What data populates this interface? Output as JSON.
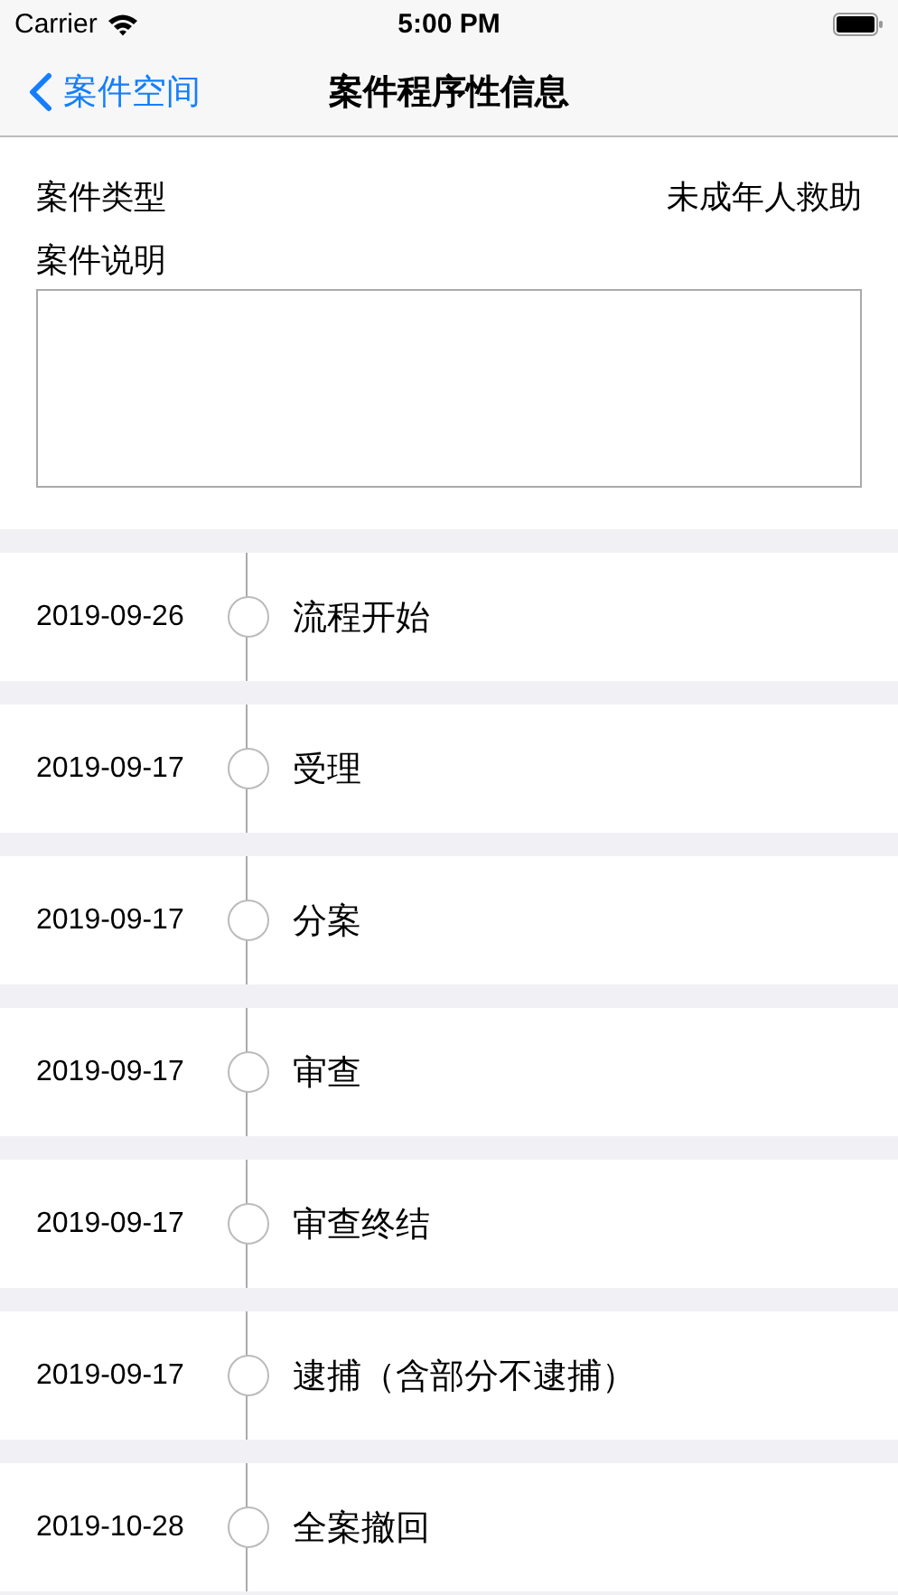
{
  "status_bar": {
    "carrier": "Carrier",
    "time": "5:00 PM"
  },
  "nav": {
    "back": "案件空间",
    "title": "案件程序性信息"
  },
  "fields": [
    {
      "label": "案件类型",
      "value": "未成年人救助"
    }
  ],
  "description": {
    "label": "案件说明"
  },
  "timeline": [
    {
      "date": "2019-09-26",
      "step": "流程开始"
    },
    {
      "date": "2019-09-17",
      "step": "受理"
    },
    {
      "date": "2019-09-17",
      "step": "分案"
    },
    {
      "date": "2019-09-17",
      "step": "审查"
    },
    {
      "date": "2019-09-17",
      "step": "审查终结"
    },
    {
      "date": "2019-09-17",
      "step": "逮捕（含部分不逮捕）"
    },
    {
      "date": "2019-10-28",
      "step": "全案撤回"
    }
  ]
}
